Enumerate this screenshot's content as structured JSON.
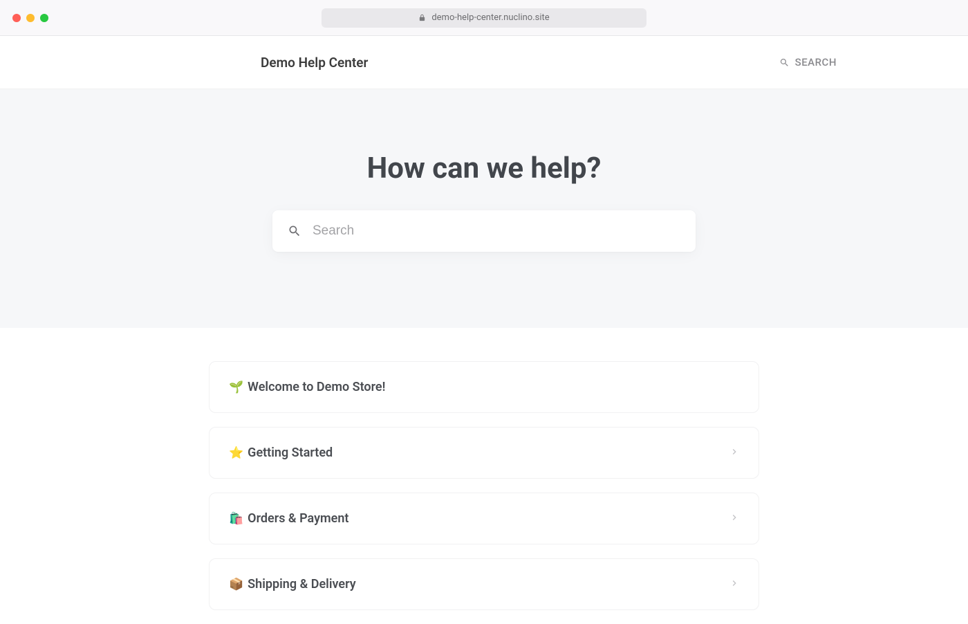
{
  "browser": {
    "url": "demo-help-center.nuclino.site"
  },
  "header": {
    "brand": "Demo Help Center",
    "search_label": "SEARCH"
  },
  "hero": {
    "heading": "How can we help?",
    "search_placeholder": "Search"
  },
  "categories": [
    {
      "emoji": "🌱",
      "title": "Welcome to Demo Store!",
      "expandable": false
    },
    {
      "emoji": "⭐",
      "title": "Getting Started",
      "expandable": true
    },
    {
      "emoji": "🛍️",
      "title": "Orders & Payment",
      "expandable": true
    },
    {
      "emoji": "📦",
      "title": "Shipping & Delivery",
      "expandable": true
    }
  ]
}
